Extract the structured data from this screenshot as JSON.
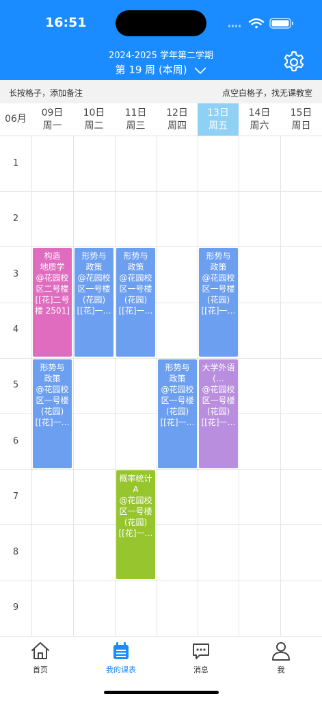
{
  "status": {
    "time": "16:51"
  },
  "header": {
    "term": "2024-2025 学年第二学期",
    "week": "第 19 周 (本周)"
  },
  "hint": {
    "left": "长按格子，添加备注",
    "right": "点空白格子，找无课教室"
  },
  "month": "06月",
  "days": [
    {
      "date": "09日",
      "weekday": "周一"
    },
    {
      "date": "10日",
      "weekday": "周二"
    },
    {
      "date": "11日",
      "weekday": "周三"
    },
    {
      "date": "12日",
      "weekday": "周四"
    },
    {
      "date": "13日",
      "weekday": "周五",
      "today": true
    },
    {
      "date": "14日",
      "weekday": "周六"
    },
    {
      "date": "15日",
      "weekday": "周日"
    }
  ],
  "periods": [
    "1",
    "2",
    "3",
    "4",
    "5",
    "6",
    "7",
    "8",
    "9"
  ],
  "courses": [
    {
      "day": 0,
      "start": 3,
      "end": 4,
      "color": "#e06cc0",
      "lines": [
        "构造",
        "地质学",
        "@花园校",
        "区二号楼",
        "[[花]二号",
        "楼 2501]"
      ]
    },
    {
      "day": 1,
      "start": 3,
      "end": 4,
      "color": "#6d9ff0",
      "lines": [
        "形势与",
        "政策",
        "@花园校",
        "区一号楼",
        "(花园)",
        "[[花]一…"
      ]
    },
    {
      "day": 2,
      "start": 3,
      "end": 4,
      "color": "#6d9ff0",
      "lines": [
        "形势与",
        "政策",
        "@花园校",
        "区一号楼",
        "(花园)",
        "[[花]一…"
      ]
    },
    {
      "day": 4,
      "start": 3,
      "end": 4,
      "color": "#6d9ff0",
      "lines": [
        "形势与",
        "政策",
        "@花园校",
        "区一号楼",
        "(花园)",
        "[[花]一…"
      ]
    },
    {
      "day": 0,
      "start": 5,
      "end": 6,
      "color": "#6d9ff0",
      "lines": [
        "形势与",
        "政策",
        "@花园校",
        "区一号楼",
        "(花园)",
        "[[花]一…"
      ]
    },
    {
      "day": 3,
      "start": 5,
      "end": 6,
      "color": "#6d9ff0",
      "lines": [
        "形势与",
        "政策",
        "@花园校",
        "区一号楼",
        "(花园)",
        "[[花]一…"
      ]
    },
    {
      "day": 4,
      "start": 5,
      "end": 6,
      "color": "#b98ede",
      "lines": [
        "大学外语",
        "(…",
        "@花园校",
        "区一号楼",
        "(花园)",
        "[[花]一…"
      ]
    },
    {
      "day": 2,
      "start": 7,
      "end": 8,
      "color": "#97c52e",
      "lines": [
        "概率统计",
        "A",
        "@花园校",
        "区一号楼",
        "(花园)",
        "[[花]一…"
      ]
    }
  ],
  "tabs": [
    {
      "label": "首页",
      "icon": "home-icon"
    },
    {
      "label": "我的课表",
      "icon": "schedule-icon",
      "active": true
    },
    {
      "label": "消息",
      "icon": "message-icon"
    },
    {
      "label": "我",
      "icon": "user-icon"
    }
  ],
  "colors": {
    "accent": "#1a8cff",
    "today": "#8fd0f5"
  }
}
